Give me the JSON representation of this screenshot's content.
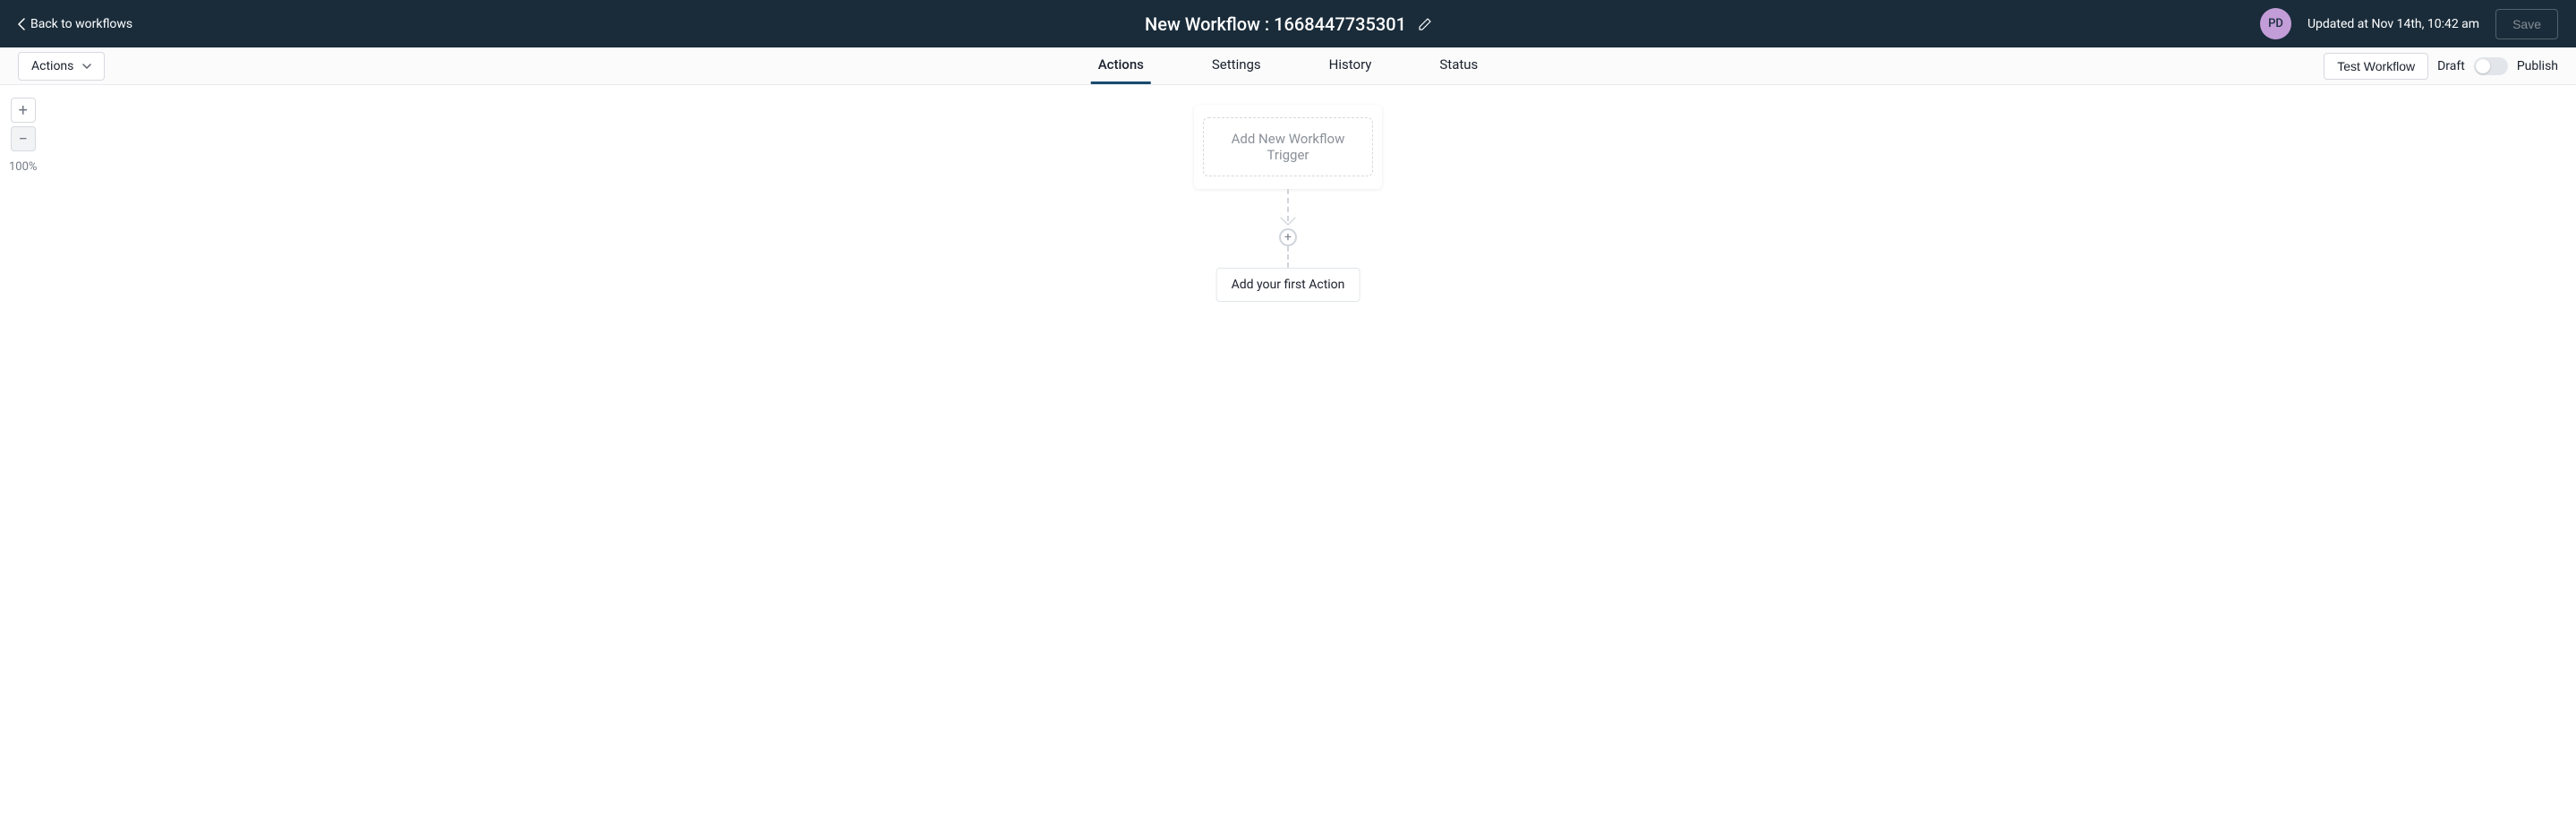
{
  "header": {
    "back_label": "Back to workflows",
    "title": "New Workflow : 1668447735301",
    "avatar_initials": "PD",
    "updated_text": "Updated at Nov 14th, 10:42 am",
    "save_label": "Save"
  },
  "subbar": {
    "actions_label": "Actions",
    "tabs": [
      {
        "label": "Actions",
        "active": true
      },
      {
        "label": "Settings",
        "active": false
      },
      {
        "label": "History",
        "active": false
      },
      {
        "label": "Status",
        "active": false
      }
    ],
    "test_label": "Test Workflow",
    "draft_label": "Draft",
    "publish_label": "Publish"
  },
  "canvas": {
    "zoom_in": "+",
    "zoom_out": "−",
    "zoom_pct": "100%",
    "trigger_text": "Add New Workflow Trigger",
    "plus": "+",
    "first_action_text": "Add your first Action"
  }
}
